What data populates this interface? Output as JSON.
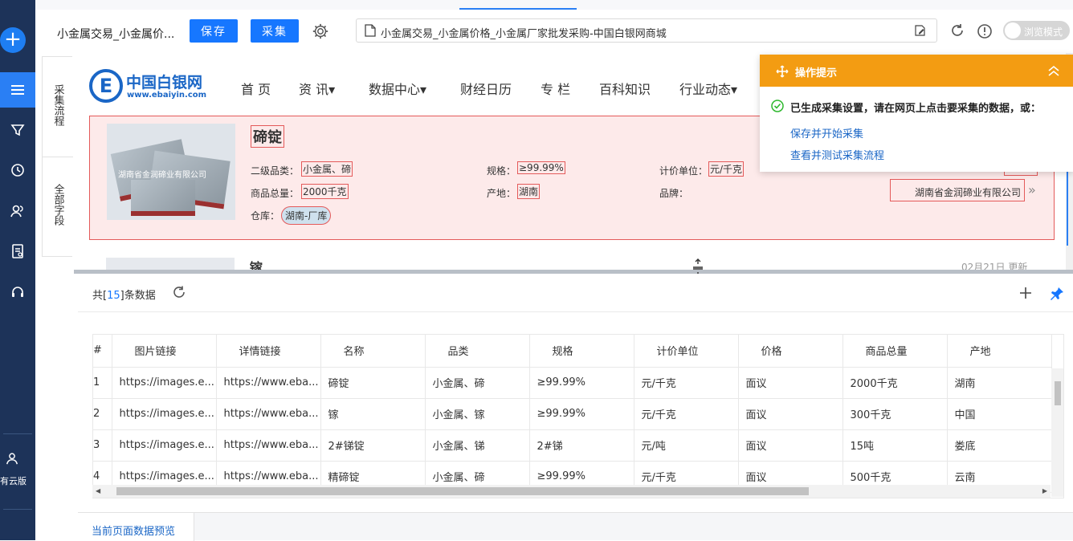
{
  "toolbar": {
    "task_title": "小金属交易_小金属价...",
    "save_label": "保存",
    "collect_label": "采集",
    "url": "小金属交易_小金属价格_小金属厂家批发采购-中国白银网商城",
    "browse_mode_label": "浏览模式"
  },
  "leftbar": {
    "cloud_label": "有云版",
    "icons": [
      "plus-icon",
      "menu-icon",
      "filter-icon",
      "history-icon",
      "users-icon",
      "document-icon",
      "headset-icon",
      "user-icon"
    ]
  },
  "side_tabs": {
    "flow": "采集流程",
    "fields": "全部字段"
  },
  "site": {
    "logo_name": "中国白银网",
    "logo_domain": "www.ebaiyin.com",
    "logo_letter": "E",
    "nav": [
      "首 页",
      "资 讯▾",
      "数据中心▾",
      "财经日历",
      "专 栏",
      "百科知识",
      "行业动态▾"
    ]
  },
  "product": {
    "image_watermark": "湖南省金润碲业有限公司",
    "title": "碲锭",
    "level2_label": "二级品类：",
    "level2_value": "小金属、碲",
    "spec_label": "规格：",
    "spec_value": "≥99.99%",
    "unit_label": "计价单位：",
    "unit_value": "元/千克",
    "total_label": "商品总量：",
    "total_value": "2000千克",
    "origin_label": "产地：",
    "origin_value": "湖南",
    "brand_label": "品牌：",
    "company": "湖南省金润碲业有限公司",
    "warehouse_label": "仓库：",
    "warehouse_value": "湖南-厂库",
    "next_title": "镓",
    "next_date": "02月21日 更新"
  },
  "tips": {
    "title": "操作提示",
    "message": "已生成采集设置，请在网页上点击要采集的数据，或：",
    "link_save_start": "保存并开始采集",
    "link_test_flow": "查看并测试采集流程"
  },
  "data_panel": {
    "count_prefix": "共[",
    "count_value": "15",
    "count_suffix": "]条数据",
    "columns": [
      "#",
      "图片链接",
      "详情链接",
      "名称",
      "品类",
      "规格",
      "计价单位",
      "价格",
      "商品总量",
      "产地"
    ],
    "rows": [
      [
        "1",
        "https://images.e...",
        "https://www.eba...",
        "碲锭",
        "小金属、碲",
        "≥99.99%",
        "元/千克",
        "面议",
        "2000千克",
        "湖南"
      ],
      [
        "2",
        "https://images.e...",
        "https://www.eba...",
        "镓",
        "小金属、镓",
        "≥99.99%",
        "元/千克",
        "面议",
        "300千克",
        "中国"
      ],
      [
        "3",
        "https://images.e...",
        "https://www.eba...",
        "2#锑锭",
        "小金属、锑",
        "2#锑",
        "元/吨",
        "面议",
        "15吨",
        "娄底"
      ],
      [
        "4",
        "https://images.e...",
        "https://www.eba...",
        "精碲锭",
        "小金属、碲",
        "≥99.99%",
        "元/千克",
        "面议",
        "500千克",
        "云南"
      ]
    ],
    "bottom_tab": "当前页面数据预览"
  },
  "colors": {
    "sidebar_bg": "#1d3359",
    "primary": "#1677ff",
    "tips_header": "#f39c12",
    "highlight_border": "#e45a5a",
    "highlight_bg": "#fdeaea"
  }
}
